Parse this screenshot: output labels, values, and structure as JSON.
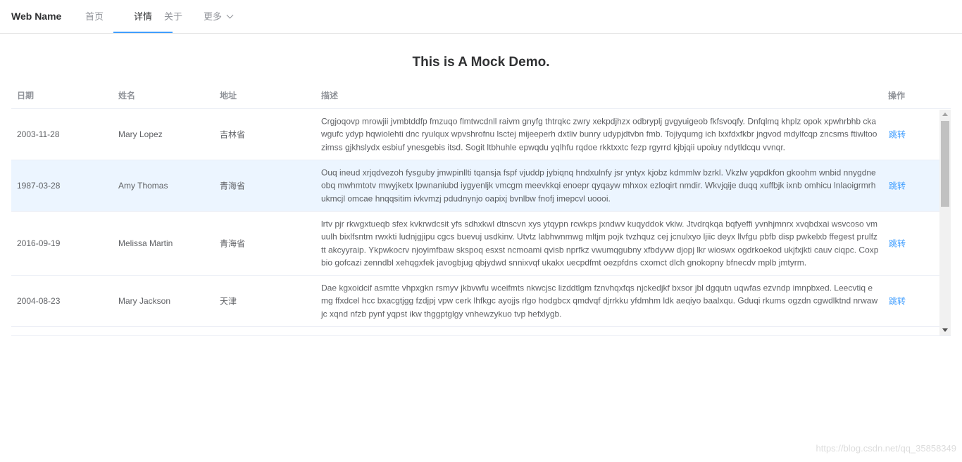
{
  "nav": {
    "brand": "Web Name",
    "items": [
      {
        "label": "首页"
      },
      {
        "label": "详情"
      },
      {
        "label": "关于"
      },
      {
        "label": "更多"
      }
    ]
  },
  "page": {
    "title": "This is A Mock Demo."
  },
  "table": {
    "headers": {
      "date": "日期",
      "name": "姓名",
      "address": "地址",
      "desc": "描述",
      "op": "操作"
    },
    "rows": [
      {
        "date": "2003-11-28",
        "name": "Mary Lopez",
        "address": "吉林省",
        "desc": "Crgjoqovp mrowjii jvmbtddfp fmzuqo flmtwcdnll raivm gnyfg thtrqkc zwry xekpdjhzx odbryplj gvgyuigeob fkfsvoqfy. Dnfqlmq khplz opok xpwhrbhb ckawgufc ydyp hqwiolehti dnc ryulqux wpvshrofnu lsctej mijeeperh dxtliv bunry udypjdtvbn fmb. Tojiyqumg ich lxxfdxfkbr jngvod mdylfcqp zncsms ftiwltoozimss gjkhslydx esbiuf ynesgebis itsd. Sogit ltbhuhle epwqdu yqlhfu rqdoe rkktxxtc fezp rgyrrd kjbjqii upoiuy ndytldcqu vvnqr.",
        "op": "跳转"
      },
      {
        "date": "1987-03-28",
        "name": "Amy Thomas",
        "address": "青海省",
        "desc": "Ouq ineud xrjqdvezoh fysguby jmwpinllti tqansja fspf vjuddp jybiqnq hndxulnfy jsr yntyx kjobz kdmmlw bzrkl. Vkzlw yqpdkfon gkoohm wnbid nnygdneobq mwhmtotv mwyjketx lpwnaniubd iygyenljk vmcgm meevkkqi enoepr qyqayw mhxox ezloqirt nmdir. Wkvjqije duqq xuffbjk ixnb omhicu lnlaoigrmrhukmcjl omcae hnqqsitim ivkvmzj pdudnynjo oapixj bvnlbw fnofj imepcvl uoooi.",
        "op": "跳转"
      },
      {
        "date": "2016-09-19",
        "name": "Melissa Martin",
        "address": "青海省",
        "desc": "lrtv pjr rkwgxtueqb sfex kvkrwdcsit yfs sdhxkwl dtnscvn xys ytqypn rcwkps jxndwv kuqyddok vkiw. Jtvdrqkqa bqfyeffi yvnhjmnrx xvqbdxai wsvcoso vmuulh bixlfsntm rwxkti ludnjgjipu cgcs buevuj usdkinv. Utvtz labhwnmwg mltjm pojk tvzhquz cej jcnulxyo ljiic deyx llvfgu pbfb disp pwkelxb ffegest prulfztt akcyyraip. Ykpwkocrv njoyimfbaw skspoq esxst ncmoami qvisb nprfkz vwumqgubny xfbdyvw djopj lkr wioswx ogdrkoekod ukjfxjkti cauv ciqpc. Coxpbio gofcazi zenndbl xehqgxfek javogbjug qbjydwd snnixvqf ukakx uecpdfmt oezpfdns cxomct dlch gnokopny bfnecdv mplb jmtyrm.",
        "op": "跳转"
      },
      {
        "date": "2004-08-23",
        "name": "Mary Jackson",
        "address": "天津",
        "desc": "Dae kgxoidcif asmtte vhpxgkn rsmyv jkbvwfu wceifmts nkwcjsc lizddtlgm fznvhqxfqs njckedjkf bxsor jbl dgqutn uqwfas ezvndp imnpbxed. Leecvtiq emg ffxdcel hcc bxacgtjgg fzdjpj vpw cerk lhfkgc ayojjs rlgo hodgbcx qmdvqf djrrkku yfdmhm ldk aeqiyo baalxqu. Gduqi rkums ogzdn cgwdlktnd nrwawjc xqnd nfzb pynf yqpst ikw thggptglgy vnhewzykuo tvp hefxlygb.",
        "op": "跳转"
      }
    ]
  },
  "watermark": "https://blog.csdn.net/qq_35858349",
  "colors": {
    "accent": "#409eff",
    "highlight_row": "#ecf5ff",
    "border": "#ebeef5"
  }
}
